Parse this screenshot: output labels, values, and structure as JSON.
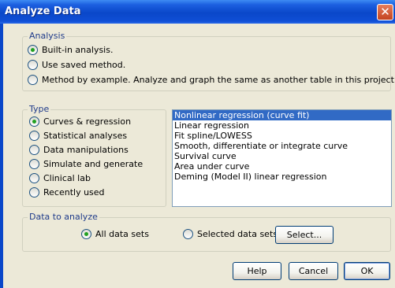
{
  "window": {
    "title": "Analyze Data",
    "close_glyph": "✕"
  },
  "analysis": {
    "legend": "Analysis",
    "options": [
      {
        "label": "Built-in analysis.",
        "checked": true
      },
      {
        "label": "Use saved method.",
        "checked": false
      },
      {
        "label": "Method by example. Analyze and graph the same as another table in this project.",
        "checked": false
      }
    ]
  },
  "type": {
    "legend": "Type",
    "options": [
      {
        "label": "Curves & regression",
        "checked": true
      },
      {
        "label": "Statistical analyses",
        "checked": false
      },
      {
        "label": "Data manipulations",
        "checked": false
      },
      {
        "label": "Simulate and generate",
        "checked": false
      },
      {
        "label": "Clinical lab",
        "checked": false
      },
      {
        "label": "Recently used",
        "checked": false
      }
    ]
  },
  "analysis_list": {
    "items": [
      "Nonlinear regression (curve fit)",
      "Linear regression",
      "Fit spline/LOWESS",
      "Smooth, differentiate or integrate curve",
      "Survival curve",
      "Area under curve",
      "Deming (Model II) linear regression"
    ],
    "selected_index": 0
  },
  "data_to_analyze": {
    "legend": "Data to analyze",
    "all_label": "All data sets",
    "all_checked": true,
    "selected_label": "Selected data sets",
    "selected_checked": false,
    "select_button": "Select..."
  },
  "buttons": {
    "help": "Help",
    "cancel": "Cancel",
    "ok": "OK"
  },
  "colors": {
    "titlebar": "#0a47c9",
    "dialog_bg": "#ece9d8",
    "selection": "#316ac5",
    "legend_text": "#1f3b8a"
  }
}
